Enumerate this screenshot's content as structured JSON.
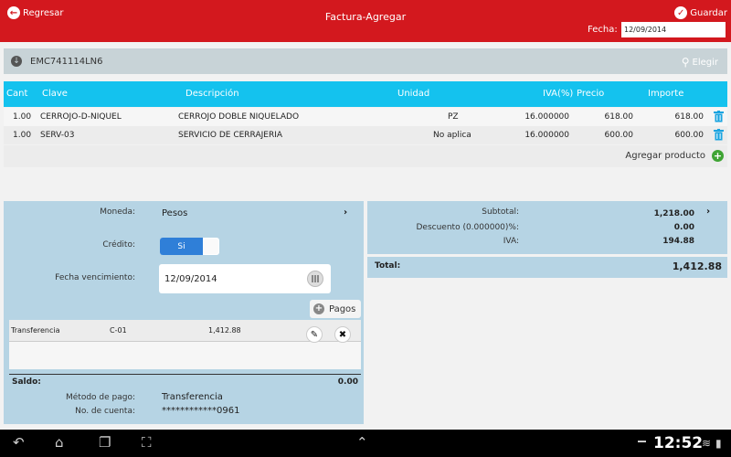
{
  "header": {
    "back_label": "Regresar",
    "title": "Factura-Agregar",
    "save_label": "Guardar",
    "fecha_label": "Fecha:",
    "fecha_value": "12/09/2014"
  },
  "customer": {
    "rfc": "EMC741114LN6",
    "choose_label": "Elegir"
  },
  "table": {
    "headers": [
      "Cant",
      "Clave",
      "Descripción",
      "Unidad",
      "IVA(%)",
      "Precio",
      "Importe"
    ],
    "rows": [
      {
        "cant": "1.00",
        "clave": "CERROJO-D-NIQUEL",
        "descripcion": "CERROJO DOBLE NIQUELADO",
        "unidad": "PZ",
        "iva": "16.000000",
        "precio": "618.00",
        "importe": "618.00"
      },
      {
        "cant": "1.00",
        "clave": "SERV-03",
        "descripcion": "SERVICIO DE CERRAJERIA",
        "unidad": "No aplica",
        "iva": "16.000000",
        "precio": "600.00",
        "importe": "600.00"
      }
    ],
    "add_product_label": "Agregar producto"
  },
  "payment": {
    "moneda_label": "Moneda:",
    "moneda_value": "Pesos",
    "credito_label": "Crédito:",
    "credito_toggle": "Si",
    "vencimiento_label": "Fecha vencimiento:",
    "vencimiento_value": "12/09/2014",
    "pagos_label": "Pagos",
    "payments": [
      {
        "method": "Transferencia",
        "ref": "C-01",
        "amount": "1,412.88"
      }
    ],
    "saldo_label": "Saldo:",
    "saldo_value": "0.00",
    "metodo_label": "Método de pago:",
    "metodo_value": "Transferencia",
    "cuenta_label": "No. de cuenta:",
    "cuenta_value": "************0961"
  },
  "totals": {
    "subtotal_label": "Subtotal:",
    "subtotal_value": "1,218.00",
    "descuento_label": "Descuento (0.000000)%:",
    "descuento_value": "0.00",
    "iva_label": "IVA:",
    "iva_value": "194.88",
    "total_label": "Total:",
    "total_value": "1,412.88"
  },
  "system": {
    "clock": "12:52"
  },
  "colors": {
    "header": "#d3181e",
    "table_header": "#14c2ee",
    "panel": "#b6d4e4",
    "toggle_on": "#2f7fd8",
    "add_green": "#3fa434",
    "trash_blue": "#1aa4e0"
  }
}
